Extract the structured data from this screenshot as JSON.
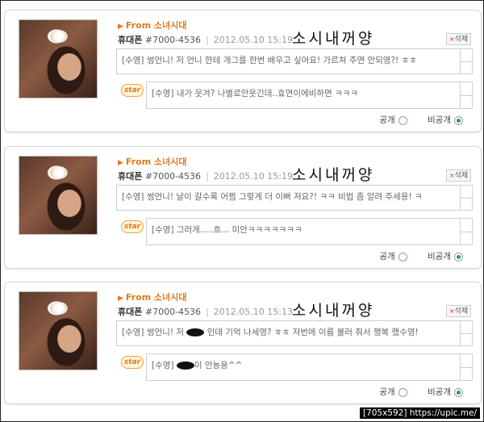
{
  "cards": [
    {
      "from": "From 소녀시대",
      "phone_label": "휴대폰",
      "phone_number": "#7000-4536",
      "datetime": "2012.05.10 15:19",
      "signature": "소시내꺼양",
      "delete_label": "삭제",
      "message": "[수영] 썽언니! 저 언니 한테 개그를 한번 배우고 싶어요! 가르쳐 주면 안되영?! ㅎㅎ",
      "star_label": "star",
      "reply_prefix": "[수영]",
      "reply_text": "내가 웃겨? 나별로안웃긴데..효연이에비하면 ㅋㅋㅋ",
      "public_label": "공개",
      "private_label": "비공개",
      "private_selected": true
    },
    {
      "from": "From 소녀시대",
      "phone_label": "휴대폰",
      "phone_number": "#7000-4536",
      "datetime": "2012.05.10 15:19",
      "signature": "소시내꺼양",
      "delete_label": "삭제",
      "message": "[수영] 썽언니! 날이 갈수록 어쩜 그렇게 더 이뻐 져요?! ㅋㅋ 비법 좀 알려 주세용! ㅋ",
      "star_label": "star",
      "reply_prefix": "[수영]",
      "reply_text": "그러게.....흐... 미안ㅋㅋㅋㅋㅋㅋㅋ",
      "public_label": "공개",
      "private_label": "비공개",
      "private_selected": true
    },
    {
      "from": "From 소녀시대",
      "phone_label": "휴대폰",
      "phone_number": "#7000-4536",
      "datetime": "2012.05.10 15:13",
      "signature": "소시내꺼양",
      "delete_label": "삭제",
      "message_prefix": "[수영] 썽언니! 저",
      "message_suffix": "인데 기억 나세영? ㅎㅎ 저번에 이름 불러 줘서 행복 했수영!",
      "star_label": "star",
      "reply_prefix": "[수영]",
      "reply_text": "이 안뇽용^^",
      "public_label": "공개",
      "private_label": "비공개",
      "private_selected": true
    }
  ],
  "watermark": "[705x592] https://upic.me/",
  "colors": {
    "accent": "#e07b1a",
    "radio_check": "#3a9a3a",
    "border": "#cfcfcf"
  }
}
